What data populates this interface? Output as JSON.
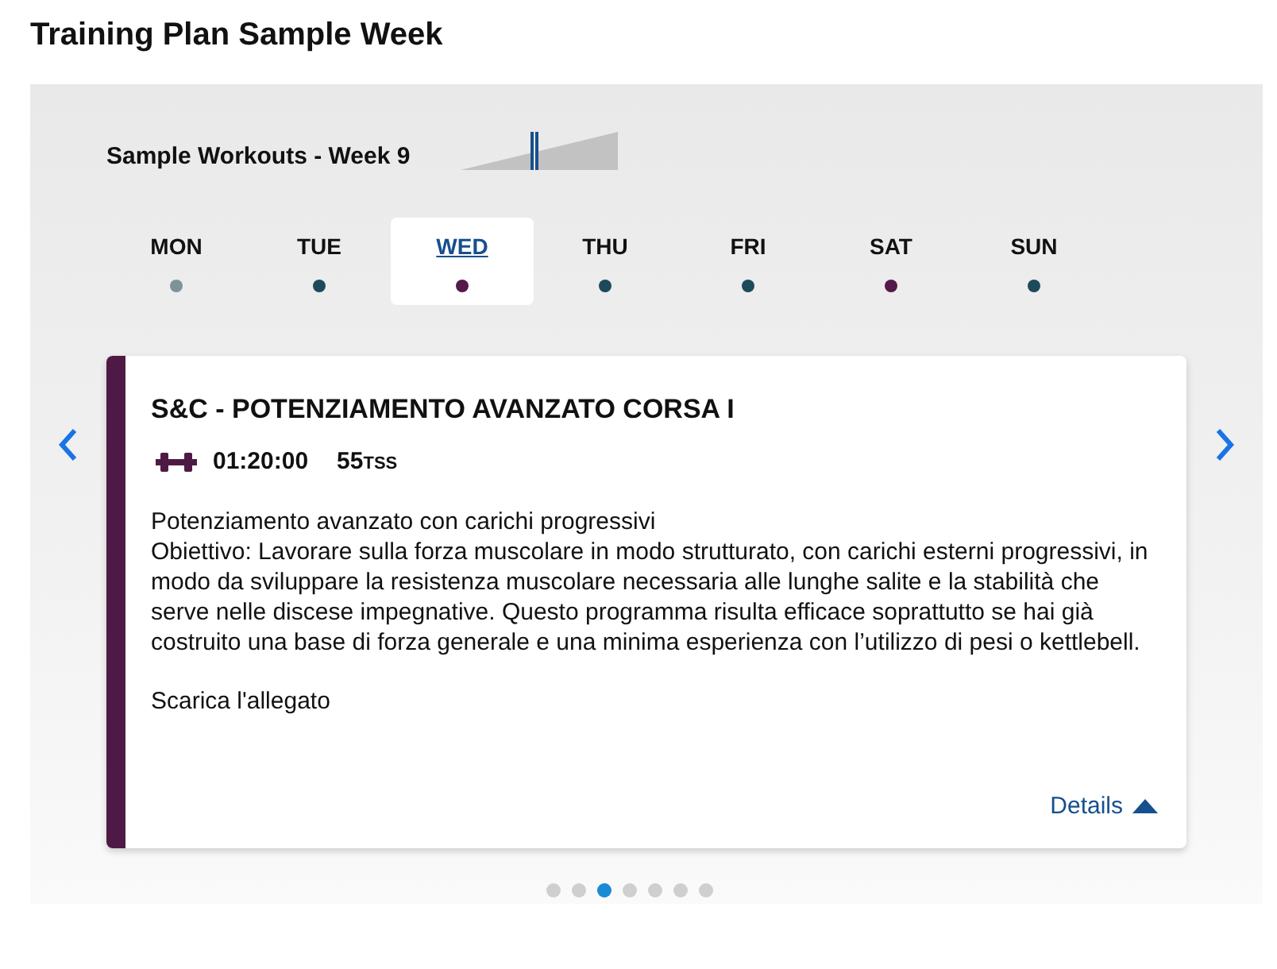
{
  "title": "Training Plan Sample Week",
  "week": {
    "label": "Sample Workouts - Week 9",
    "level": 0.46
  },
  "days": [
    {
      "label": "MON",
      "selected": false,
      "color": "#7f9299"
    },
    {
      "label": "TUE",
      "selected": false,
      "color": "#1d4a5a"
    },
    {
      "label": "WED",
      "selected": true,
      "color": "#55194a"
    },
    {
      "label": "THU",
      "selected": false,
      "color": "#1d4a5a"
    },
    {
      "label": "FRI",
      "selected": false,
      "color": "#1d4a5a"
    },
    {
      "label": "SAT",
      "selected": false,
      "color": "#55194a"
    },
    {
      "label": "SUN",
      "selected": false,
      "color": "#1d4a5a"
    }
  ],
  "workout": {
    "color": "#4e1a45",
    "title": "S&C - POTENZIAMENTO AVANZATO CORSA I",
    "duration": "01:20:00",
    "tss": "55",
    "tss_unit": "TSS",
    "paragraphs": [
      "Potenziamento avanzato con carichi progressivi",
      "Obiettivo: Lavorare sulla forza muscolare in modo strutturato, con carichi esterni progressivi, in modo da sviluppare la resistenza muscolare necessaria alle lunghe salite e la stabilità che serve nelle discese impegnative. Questo programma risulta efficace soprattutto se hai già costruito una base di forza generale e una minima esperienza con l’utilizzo di pesi o kettlebell."
    ],
    "attachment": "Scarica l'allegato",
    "details": "Details"
  },
  "pager": [
    {
      "selected": false
    },
    {
      "selected": false
    },
    {
      "selected": true
    },
    {
      "selected": false
    },
    {
      "selected": false
    },
    {
      "selected": false
    },
    {
      "selected": false
    }
  ]
}
